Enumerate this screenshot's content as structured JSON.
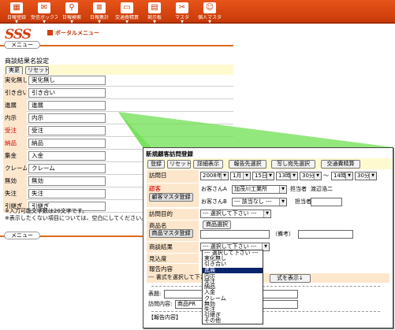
{
  "toolbar": {
    "items": [
      {
        "label": "日報登録",
        "icon": "calendar-icon",
        "glyph": "▦"
      },
      {
        "label": "受信ボックス",
        "icon": "envelope-icon",
        "glyph": "✉"
      },
      {
        "label": "日報検索",
        "icon": "magnifier-icon",
        "glyph": "⚲"
      },
      {
        "label": "日報集計",
        "icon": "list-icon",
        "glyph": "≡"
      },
      {
        "label": "交通費精算",
        "icon": "train-icon",
        "glyph": "▭"
      },
      {
        "label": "掲示板",
        "icon": "board-icon",
        "glyph": "▤"
      },
      {
        "label": "マスタ",
        "icon": "tools-icon",
        "glyph": "✂"
      },
      {
        "label": "個人マスタ",
        "icon": "person-icon",
        "glyph": "☺"
      }
    ],
    "dropdown_glyph": "▼"
  },
  "logo": "SSS",
  "portal_menu": "ポータルメニュー",
  "menu_label": "メニュー",
  "section_title": "商談結果名設定",
  "buttons": {
    "confirm": "実更",
    "reset": "リセット"
  },
  "result_rows": [
    {
      "label": "実化無し",
      "value": "実化無し",
      "red": false
    },
    {
      "label": "引き合い",
      "value": "引き合い",
      "red": false
    },
    {
      "label": "進展",
      "value": "進展",
      "red": false
    },
    {
      "label": "内示",
      "value": "内示",
      "red": false
    },
    {
      "label": "受注",
      "value": "受注",
      "red": true
    },
    {
      "label": "納品",
      "value": "納品",
      "red": true
    },
    {
      "label": "集金",
      "value": "入金",
      "red": false
    },
    {
      "label": "クレーム",
      "value": "クレーム",
      "red": false
    },
    {
      "label": "無効",
      "value": "無効",
      "red": false
    },
    {
      "label": "失注",
      "value": "失注",
      "red": false
    },
    {
      "label": "引継ぎ",
      "value": "引継ぎ",
      "red": false
    }
  ],
  "notes": [
    "※入力可能文字数は20文字です。",
    "※表示したくない項目については、空白にしてください。"
  ],
  "dialog": {
    "title": "新規顧客訪問登録",
    "top_buttons": [
      "登録",
      "リセット",
      "詳細表示",
      "報告先選択",
      "写し宛先選択",
      "交通費精算"
    ],
    "visit_date_label": "訪問日",
    "year": "2008年",
    "month": "1月",
    "day": "15日",
    "start_hour": "13時",
    "start_min": "30分",
    "tilde": "〜",
    "end_hour": "14時",
    "end_min": "30分",
    "customer_label": "顧客",
    "customer_master_btn": "顧客マスタ登録",
    "customer_a_label": "お客さんA",
    "customer_a_value": "加茂川工業所",
    "person_in_charge_label": "担当者",
    "person_in_charge_value": "渡辺浩二",
    "customer_b_label": "お客さんB",
    "customer_b_value": "--- 該当なし ---",
    "person_in_charge_b_label": "担当者",
    "purpose_label": "訪問目的",
    "purpose_value": "--- 選択して下さい ---",
    "product_label": "商品名",
    "product_select_btn": "商品選択",
    "product_master_btn": "商品マスタ登録",
    "remarks_label": "（備考）",
    "result_label": "商談結果",
    "result_value": "--- 選択して下さい ---",
    "forecast_label": "見込度",
    "report_label": "報告内容",
    "format_select": "--- 書式を選択して下さい",
    "format_show": "式を表示↓",
    "heading_label": "表題:",
    "visit_content_label": "訪問内容:",
    "visit_content_value": "商品PR",
    "report_content_label": "【報告内容】",
    "dropdown_options": [
      "--- 選択して下さい ---",
      "実化無し",
      "引き合い",
      "進展",
      "内示",
      "受注",
      "納品",
      "入金",
      "クレーム",
      "無効",
      "失注",
      "引継ぎ",
      "その他"
    ],
    "dropdown_selected_index": 3
  },
  "colors": {
    "accent": "#d04010",
    "label_bg": "#fde7cc",
    "highlight": "#0a246a",
    "green": "#66dd44"
  }
}
